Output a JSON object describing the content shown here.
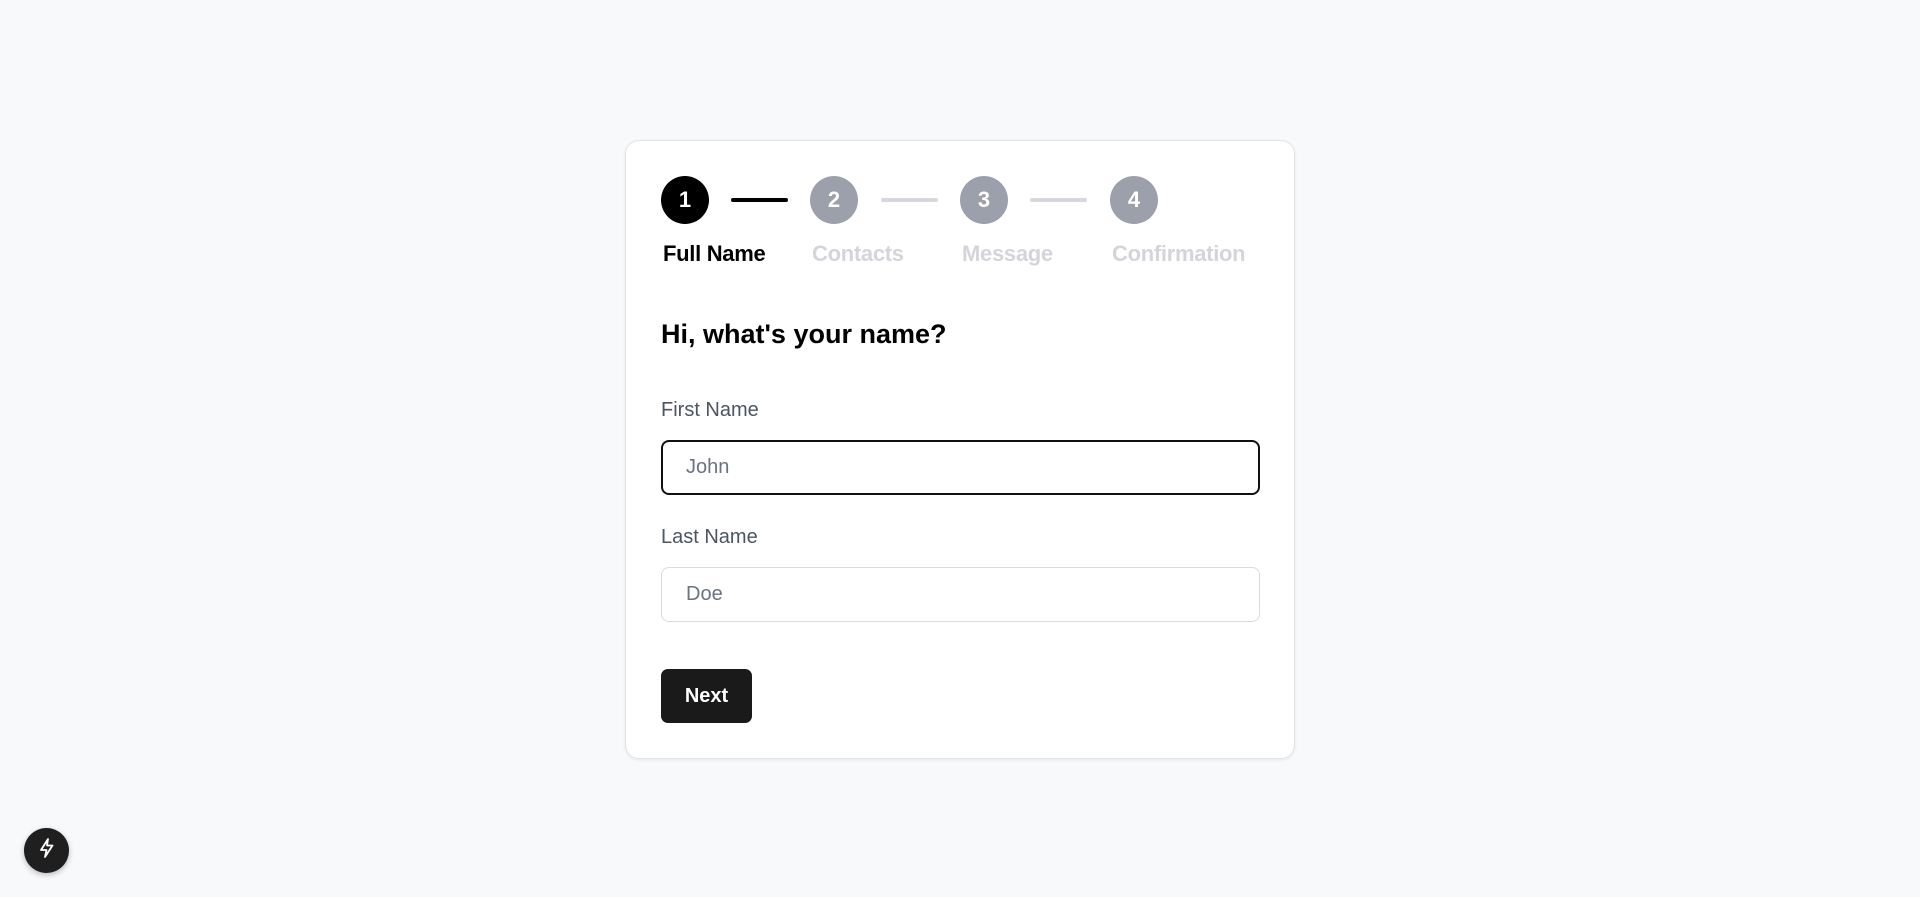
{
  "stepper": {
    "steps": [
      {
        "number": "1",
        "label": "Full Name",
        "state": "active"
      },
      {
        "number": "2",
        "label": "Contacts",
        "state": "inactive"
      },
      {
        "number": "3",
        "label": "Message",
        "state": "inactive"
      },
      {
        "number": "4",
        "label": "Confirmation",
        "state": "inactive"
      }
    ]
  },
  "form": {
    "heading": "Hi, what's your name?",
    "first_name": {
      "label": "First Name",
      "value": "",
      "placeholder": "John"
    },
    "last_name": {
      "label": "Last Name",
      "value": "",
      "placeholder": "Doe"
    },
    "next_label": "Next"
  },
  "fab": {
    "icon": "lightning-bolt-icon"
  },
  "colors": {
    "page_background": "#f8f9fb",
    "active": "#000000",
    "inactive_circle": "#9ca0aa",
    "inactive_label": "#d3d5da",
    "button": "#1a1a1a"
  }
}
